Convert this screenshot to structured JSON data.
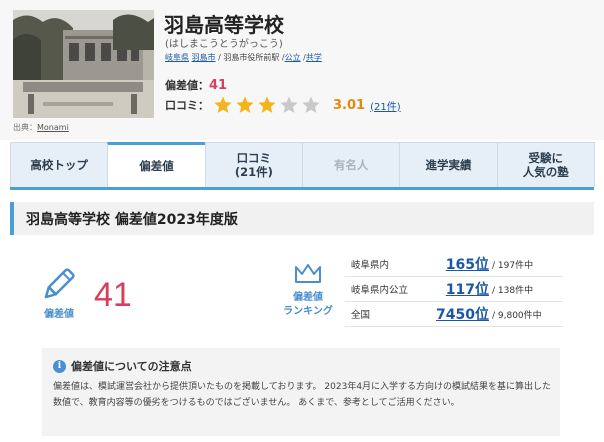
{
  "school": {
    "name": "羽島高等学校",
    "kana": "(はしまこうとうがっこう)",
    "prefecture": "岐阜県",
    "city": "羽島市",
    "station": "羽島市役所前駅",
    "type": "公立",
    "coed": "共学",
    "sep": "/",
    "credit_label": "出典：",
    "credit_source": "Monami",
    "deviation_label": "偏差値：",
    "deviation_value": "41",
    "review_label": "口コミ：",
    "rating": 3.01,
    "rating_text": "3.01",
    "review_count": "(21件)",
    "stars": [
      "full",
      "full",
      "full",
      "empty",
      "empty"
    ]
  },
  "tabs": [
    {
      "label": "高校トップ",
      "state": "normal"
    },
    {
      "label": "偏差値",
      "state": "active"
    },
    {
      "label": "口コミ\n(21件)",
      "state": "normal"
    },
    {
      "label": "有名人",
      "state": "disabled"
    },
    {
      "label": "進学実績",
      "state": "normal"
    },
    {
      "label": "受験に\n人気の塾",
      "state": "normal"
    }
  ],
  "section": {
    "title": "羽島高等学校 偏差値2023年度版",
    "deviation_label": "偏差値",
    "deviation_value": "41",
    "ranking_label": "偏差値\nランキング"
  },
  "rankings": [
    {
      "area": "岐阜県内",
      "rank": "165位",
      "total": "/ 197件中"
    },
    {
      "area": "岐阜県内公立",
      "rank": "117位",
      "total": "/ 138件中"
    },
    {
      "area": "全国",
      "rank": "7450位",
      "total": "/ 9,800件中"
    }
  ],
  "notice": {
    "title": "偏差値についての注意点",
    "body": "偏差値は、模試運営会社から提供頂いたものを掲載しております。 2023年4月に入学する方向けの模試結果を基に算出した数値で、教育内容等の優劣をつけるものではございません。 あくまで、参考としてご活用ください。"
  },
  "colors": {
    "accent": "#4a9fd8",
    "deviation": "#d6405e",
    "star": "#f2b51d",
    "link": "#1a57a8"
  },
  "icons": {
    "pencil": "pencil-icon",
    "crown": "crown-icon",
    "info": "info-icon",
    "star": "star-icon"
  }
}
